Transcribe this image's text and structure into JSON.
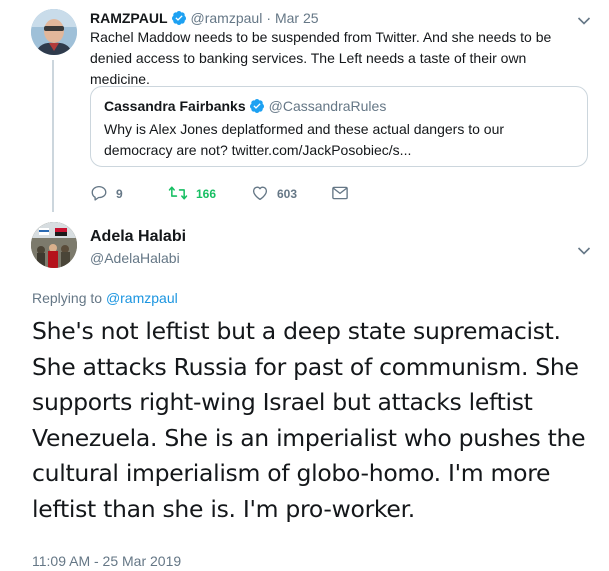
{
  "parent_tweet": {
    "author_name": "RAMZPAUL",
    "author_handle": "@ramzpaul",
    "separator": "·",
    "date": "Mar 25",
    "text": "Rachel Maddow needs to be suspended from Twitter. And she needs to be denied access to banking services. The Left needs a taste of their own medicine.",
    "quoted": {
      "author_name": "Cassandra Fairbanks",
      "author_handle": "@CassandraRules",
      "text": "Why is Alex Jones deplatformed and these actual dangers to our democracy are not? twitter.com/JackPosobiec/s..."
    },
    "actions": {
      "replies": "9",
      "retweets": "166",
      "likes": "603"
    }
  },
  "reply_tweet": {
    "author_name": "Adela Halabi",
    "author_handle": "@AdelaHalabi",
    "replying_prefix": "Replying to",
    "replying_to": "@ramzpaul",
    "text": "She's not leftist but a deep state supremacist. She attacks Russia for past of communism. She supports right-wing Israel but attacks leftist Venezuela. She is an imperialist who pushes the cultural imperialism of globo-homo. I'm more leftist than she is. I'm pro-worker.",
    "timestamp": "11:09 AM - 25 Mar 2019"
  },
  "colors": {
    "verified": "#1da1f2",
    "retweet_active": "#17bf63",
    "muted": "#657786",
    "link": "#1b95e0"
  },
  "icons": [
    "verified-badge-icon",
    "chevron-down-icon",
    "reply-icon",
    "retweet-icon",
    "like-icon",
    "direct-message-icon"
  ]
}
